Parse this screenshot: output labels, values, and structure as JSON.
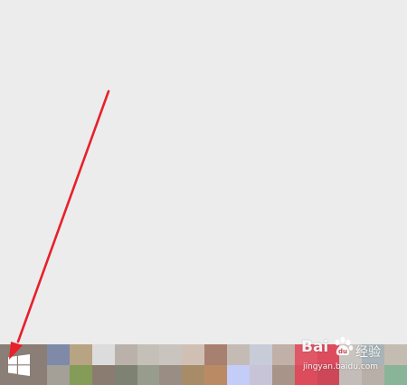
{
  "desktop": {
    "background": "#ececec"
  },
  "taskbar": {
    "start_icon": "windows-logo-icon",
    "tile_rows": [
      [
        "#7e8aa8",
        "#b8a482",
        "#dcdcdc",
        "#bab2aa",
        "#c4c0b8",
        "#cac4be",
        "#d0c0b4",
        "#a88070",
        "#c4bcb4",
        "#c8ccd8",
        "#c0b0a8",
        "#e05868",
        "#dc4c5c",
        "#c8c4c0",
        "#a8b4b8",
        "#c4bcb0"
      ],
      [
        "#a4a098",
        "#849c58",
        "#8a7c70",
        "#7e8272",
        "#989c8c",
        "#9a8e84",
        "#a88c68",
        "#ba8a64",
        "#c4ccf8",
        "#c8c4d8",
        "#a89488",
        "#dc4c5c",
        "#cc4858",
        "#c4bcb8",
        "#b8b0a8",
        "#8ab498"
      ]
    ]
  },
  "annotation": {
    "arrow_icon": "red-arrow-icon",
    "color": "#e8202a"
  },
  "watermark": {
    "brand": "Bai",
    "paw_icon": "baidu-paw-icon",
    "cn": "经验",
    "url": "jingyan.baidu.com"
  }
}
